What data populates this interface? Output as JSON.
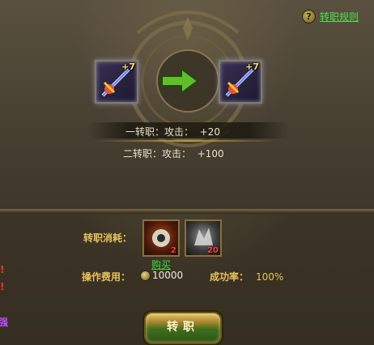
{
  "header": {
    "rules_link_label": "转职规则",
    "help_icon_glyph": "?"
  },
  "upgrade": {
    "source_item": {
      "icon": "sword-item-icon",
      "enhance_label": "+7"
    },
    "arrow_icon": "green-right-arrow-icon",
    "target_item": {
      "icon": "sword-item-icon",
      "enhance_label": "+7"
    }
  },
  "stats": [
    {
      "label": "一转职：攻击：  +20"
    },
    {
      "label": "二转职：攻击：  +100"
    }
  ],
  "cost": {
    "label": "转职消耗：",
    "materials": [
      {
        "icon": "orange-orb-material-icon",
        "count": "2"
      },
      {
        "icon": "gray-stone-material-icon",
        "count": "20"
      }
    ],
    "buy_label": "购买"
  },
  "fee": {
    "label": "操作费用：",
    "coin_icon": "gold-coin-icon",
    "value": "10000"
  },
  "success": {
    "label": "成功率：",
    "value": "100%"
  },
  "action_button": {
    "label": "转职"
  },
  "left_edge": {
    "marks": [
      "!",
      "!",
      "强"
    ]
  },
  "colors": {
    "accent_gold": "#e8c25b",
    "link_green": "#4fe04f",
    "count_red": "#ff4040"
  }
}
